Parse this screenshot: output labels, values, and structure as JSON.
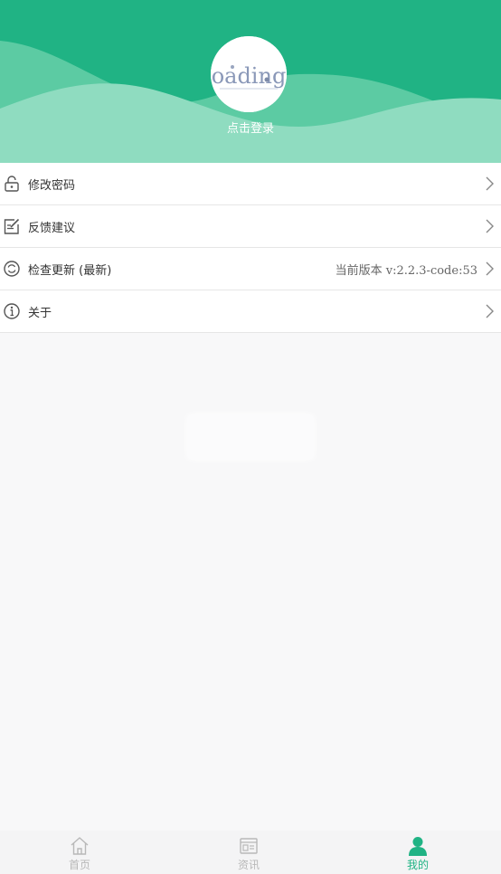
{
  "colors": {
    "brand": "#20b384",
    "header_light": "#8fdcc0",
    "wave_light": "#6fd0ab",
    "tab_inactive": "#b8b8b8"
  },
  "header": {
    "avatar_text": "oading",
    "login_label": "点击登录"
  },
  "menu": {
    "items": [
      {
        "icon": "lock-icon",
        "label": "修改密码",
        "value": ""
      },
      {
        "icon": "edit-icon",
        "label": "反馈建议",
        "value": ""
      },
      {
        "icon": "refresh-icon",
        "label": "检查更新 (最新)",
        "value": "当前版本  v:2.2.3-code:53"
      },
      {
        "icon": "info-icon",
        "label": "关于",
        "value": ""
      }
    ]
  },
  "tabbar": {
    "tabs": [
      {
        "icon": "home-icon",
        "label": "首页",
        "active": false
      },
      {
        "icon": "news-icon",
        "label": "资讯",
        "active": false
      },
      {
        "icon": "user-icon",
        "label": "我的",
        "active": true
      }
    ]
  }
}
